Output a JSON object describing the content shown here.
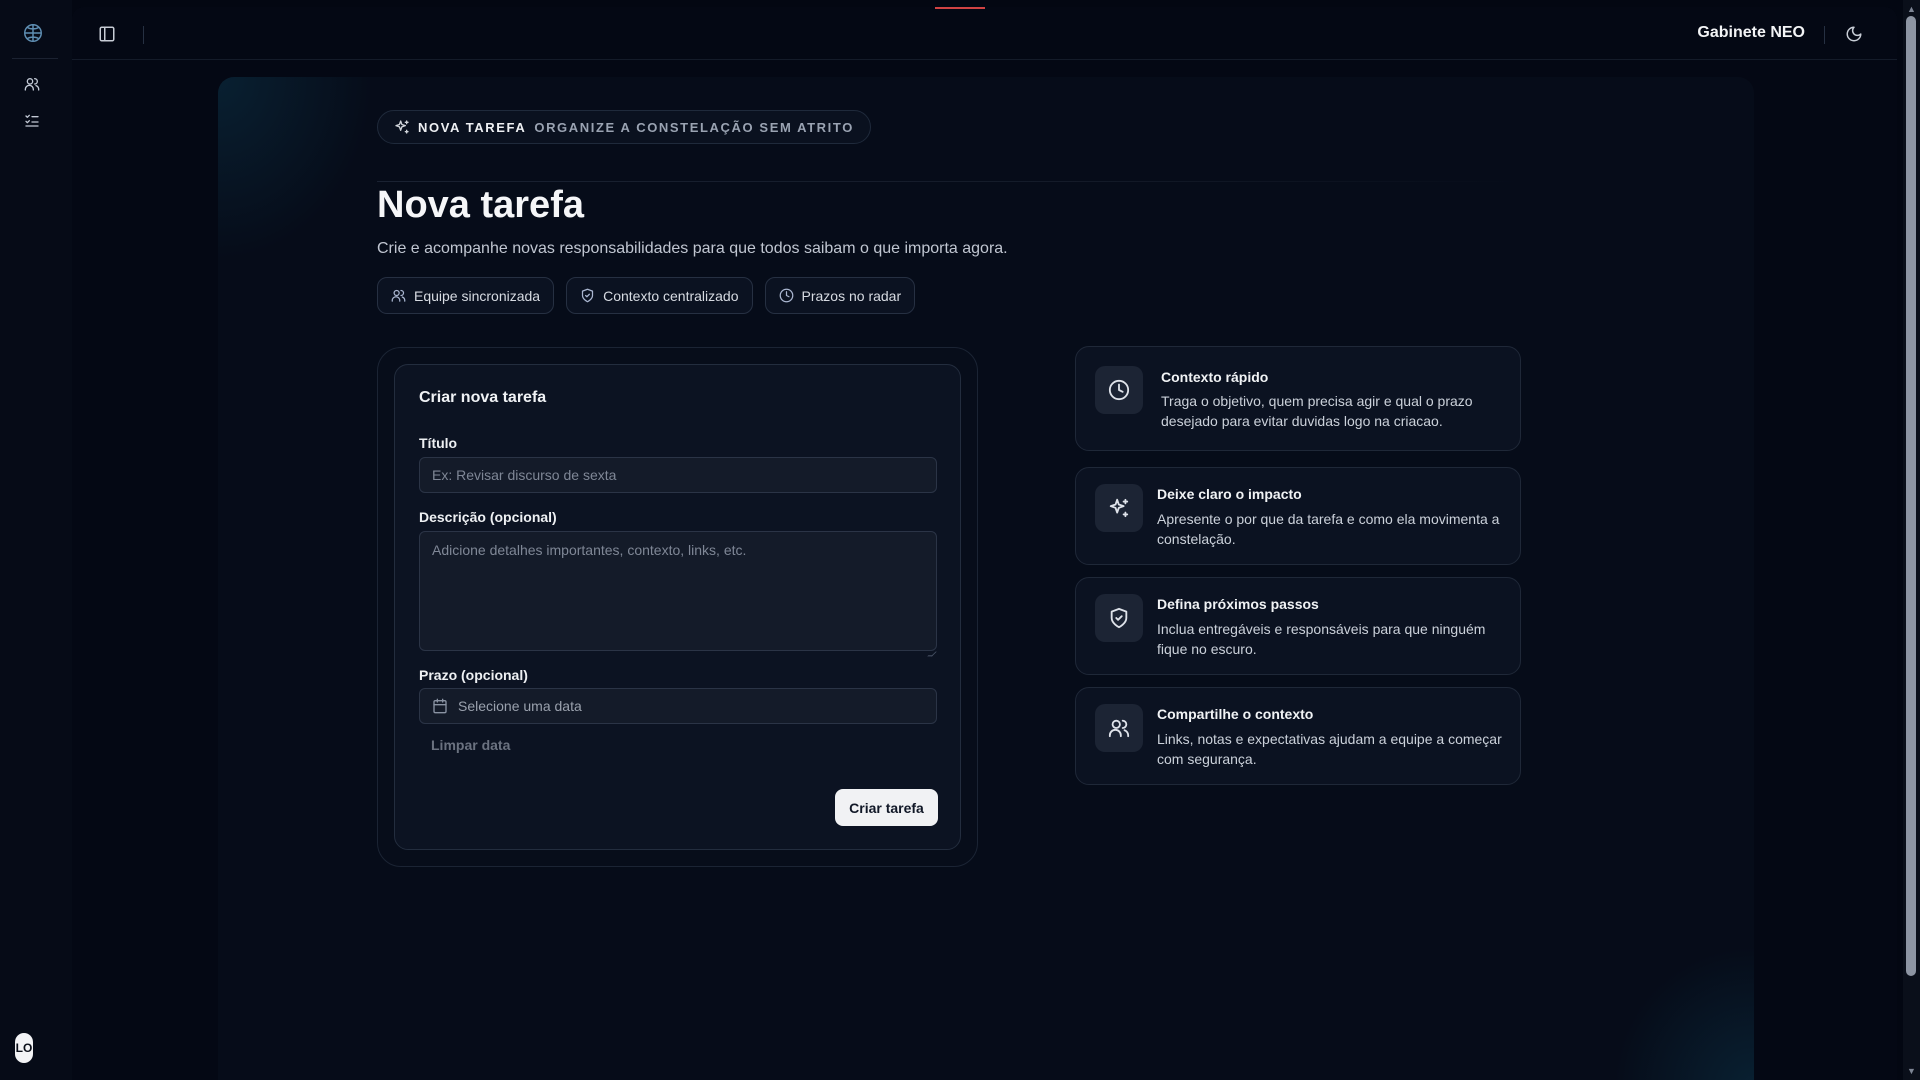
{
  "topbar": {
    "brand": "Gabinete NEO"
  },
  "rail": {
    "avatar_initials": "LO"
  },
  "hero": {
    "pill_strong": "NOVA TAREFA",
    "pill_muted": "ORGANIZE A CONSTELAÇÃO SEM ATRITO",
    "title": "Nova tarefa",
    "subtitle": "Crie e acompanhe novas responsabilidades para que todos saibam o que importa agora.",
    "chips": [
      {
        "label": "Equipe sincronizada",
        "icon": "users-icon"
      },
      {
        "label": "Contexto centralizado",
        "icon": "shield-check-icon"
      },
      {
        "label": "Prazos no radar",
        "icon": "clock-icon"
      }
    ]
  },
  "form": {
    "title": "Criar nova tarefa",
    "title_label": "Título",
    "title_placeholder": "Ex: Revisar discurso de sexta",
    "description_label": "Descrição (opcional)",
    "description_placeholder": "Adicione detalhes importantes, contexto, links, etc.",
    "deadline_label": "Prazo (opcional)",
    "deadline_placeholder": "Selecione uma data",
    "clear_label": "Limpar data",
    "submit_label": "Criar tarefa"
  },
  "tips": [
    {
      "icon": "clock-icon",
      "title": "Contexto rápido",
      "body": "Traga o objetivo, quem precisa agir e qual o prazo desejado para evitar duvidas logo na criacao."
    },
    {
      "icon": "sparkles-icon",
      "title": "Deixe claro o impacto",
      "body": "Apresente o por que da tarefa e como ela movimenta a constelação."
    },
    {
      "icon": "shield-check-icon",
      "title": "Defina próximos passos",
      "body": "Inclua entregáveis e responsáveis para que ninguém fique no escuro."
    },
    {
      "icon": "users-icon",
      "title": "Compartilhe o contexto",
      "body": "Links, notas e expectativas ajudam a equipe a começar com segurança."
    }
  ],
  "colors": {
    "background": "#030712",
    "card": "#0c1322",
    "accent": "#5f8fb3",
    "primary_button": "#f1f2f4"
  }
}
